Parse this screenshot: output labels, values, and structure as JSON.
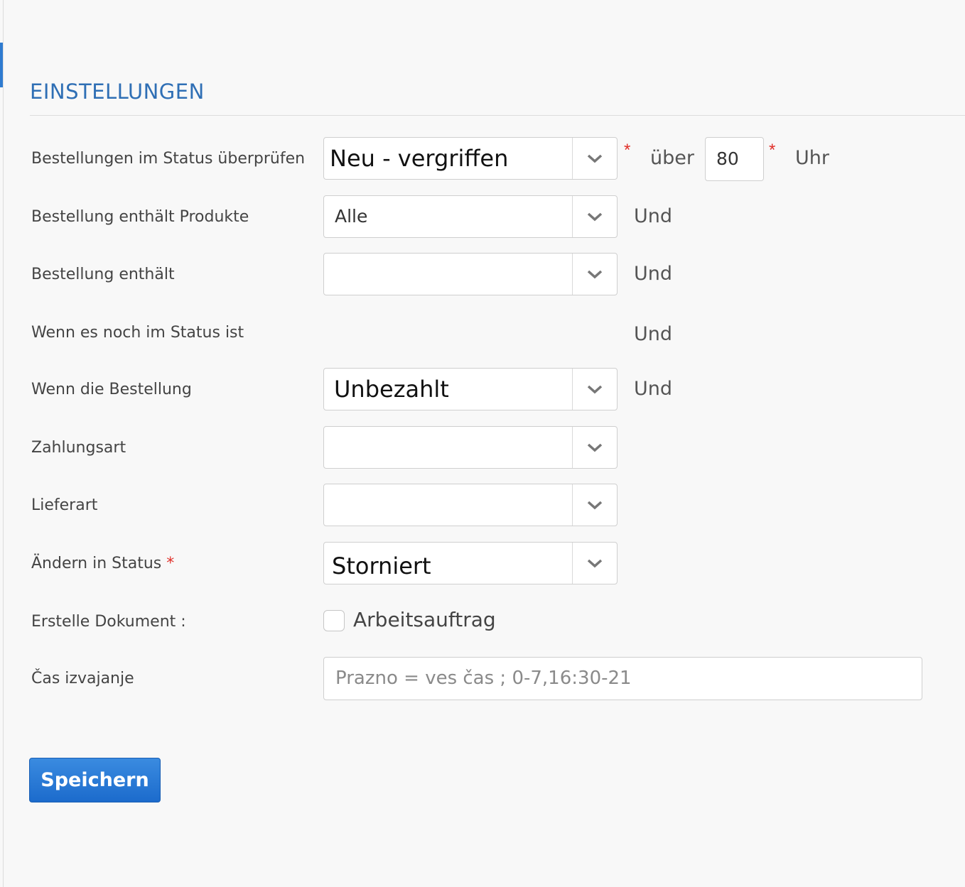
{
  "section": {
    "title": "EINSTELLUNGEN"
  },
  "rows": {
    "check_status": {
      "label": "Bestellungen im Status überprüfen",
      "value": "Neu - vergriffen",
      "over_label": "über",
      "hours_value": "80",
      "hours_unit": "Uhr"
    },
    "contains_products": {
      "label": "Bestellung enthält Produkte",
      "value": "Alle",
      "conj": "Und"
    },
    "contains": {
      "label": "Bestellung enthält",
      "value": "",
      "conj": "Und"
    },
    "still_in_status": {
      "label": "Wenn es noch im Status ist",
      "conj": "Und"
    },
    "order_if": {
      "label": "Wenn die Bestellung",
      "value": "Unbezahlt",
      "conj": "Und"
    },
    "payment": {
      "label": "Zahlungsart",
      "value": ""
    },
    "delivery": {
      "label": "Lieferart",
      "value": ""
    },
    "change_status": {
      "label": "Ändern in Status",
      "required_mark": "*",
      "value": "Storniert"
    },
    "create_document": {
      "label": "Erstelle Dokument :",
      "checkbox_label": "Arbeitsauftrag",
      "checked": false
    },
    "execution_time": {
      "label": "Čas izvajanje",
      "placeholder": "Prazno = ves čas ; 0-7,16:30-21"
    }
  },
  "required_mark": "*",
  "save_button": {
    "label": "Speichern"
  },
  "colors": {
    "accent": "#2f6fb5",
    "button": "#1f6fcf",
    "required": "#e0302a"
  },
  "icons": {
    "select_arrow": "chevron-down-icon"
  }
}
